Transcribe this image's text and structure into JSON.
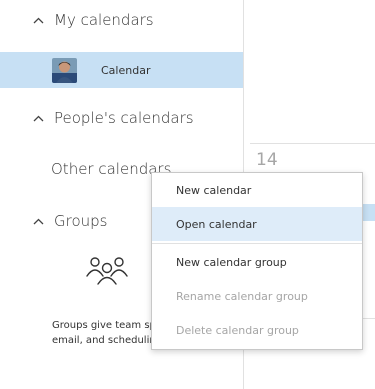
{
  "sidebar": {
    "my_calendars": {
      "title": "My calendars",
      "items": [
        {
          "label": "Calendar",
          "selected": true
        }
      ]
    },
    "peoples_calendars": {
      "title": "People's calendars"
    },
    "other_calendars": {
      "title": "Other calendars"
    },
    "groups": {
      "title": "Groups",
      "description": "Groups give team space for email, and scheduling events."
    }
  },
  "calendar_view": {
    "day_number": "14"
  },
  "context_menu": {
    "items": [
      {
        "label": "New calendar",
        "enabled": true,
        "highlighted": false
      },
      {
        "label": "Open calendar",
        "enabled": true,
        "highlighted": true
      },
      {
        "label": "New calendar group",
        "enabled": true,
        "highlighted": false
      },
      {
        "label": "Rename calendar group",
        "enabled": false,
        "highlighted": false
      },
      {
        "label": "Delete calendar group",
        "enabled": false,
        "highlighted": false
      }
    ]
  },
  "colors": {
    "selected_background": "#c7e0f4",
    "menu_hover_background": "#deecf9",
    "disabled_text": "#a6a6a6",
    "text": "#333333"
  },
  "icons": {
    "section_toggle": "chevron-up-icon",
    "groups_illustration": "groups-icon"
  }
}
